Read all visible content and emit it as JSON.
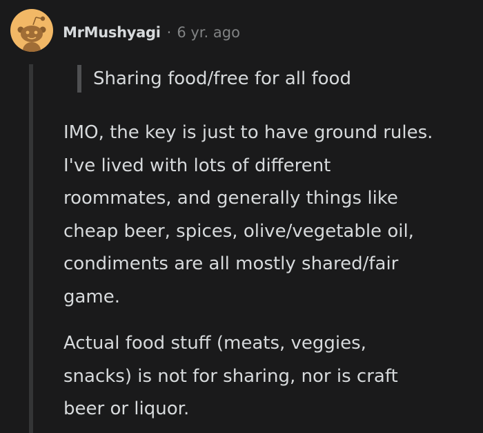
{
  "comment": {
    "author": "MrMushyagi",
    "separator": "·",
    "age": "6 yr. ago",
    "quote": "Sharing food/free for all food",
    "paragraph_1": "IMO, the key is just to have ground rules.\nI've lived with lots of different\nroommates, and generally things like\ncheap beer, spices, olive/vegetable oil,\ncondiments are all mostly shared/fair\ngame.",
    "paragraph_2": "Actual food stuff (meats, veggies,\nsnacks) is not for sharing, nor is craft\nbeer or liquor."
  },
  "avatar_icon": "snoo-avatar-icon",
  "colors": {
    "background": "#1a1a1b",
    "text": "#d7dadc",
    "meta_text": "#818384",
    "thread_line": "#343536",
    "quote_bar": "#4f5052",
    "avatar_background": "#f2b866"
  }
}
